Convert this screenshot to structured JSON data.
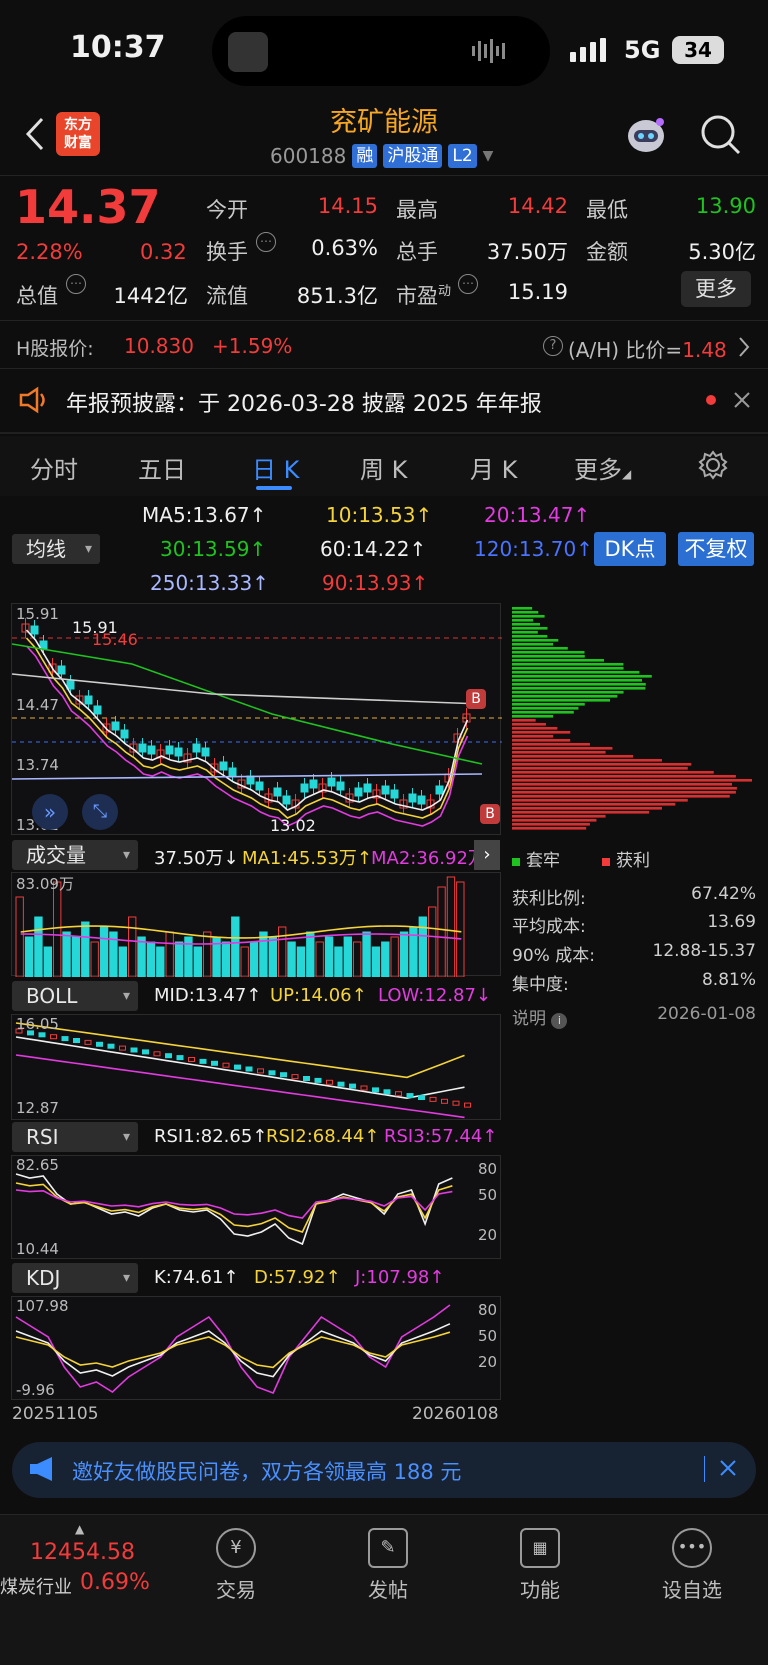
{
  "status": {
    "time": "10:37",
    "network": "5G",
    "battery": "34"
  },
  "header": {
    "logo_line1": "东方",
    "logo_line2": "财富",
    "title": "兖矿能源",
    "code": "600188",
    "tags": [
      "融",
      "沪股通",
      "L2"
    ]
  },
  "quote": {
    "price": "14.37",
    "pct": "2.28%",
    "change": "0.32",
    "open_label": "今开",
    "open": "14.15",
    "high_label": "最高",
    "high": "14.42",
    "low_label": "最低",
    "low": "13.90",
    "turnover_label": "换手",
    "turnover": "0.63%",
    "volume_label": "总手",
    "volume": "37.50万",
    "amount_label": "金额",
    "amount": "5.30亿",
    "mcap_label": "总值",
    "mcap": "1442亿",
    "float_label": "流值",
    "float": "851.3亿",
    "pe_label": "市盈",
    "pe_sup": "动",
    "pe": "15.19",
    "more": "更多"
  },
  "hshare": {
    "label": "H股报价:",
    "price": "10.830",
    "pct": "+1.59%",
    "ah_label": "(A/H) 比价=",
    "ah": "1.48"
  },
  "notice": {
    "text": "年报预披露：于 2026-03-28 披露 2025 年年报"
  },
  "tabs": [
    "分时",
    "五日",
    "日 K",
    "周 K",
    "月 K",
    "更多"
  ],
  "ma": {
    "selector": "均线",
    "ma5": "MA5:13.67↑",
    "ma10": "10:13.53↑",
    "ma20": "20:13.47↑",
    "ma30": "30:13.59↑",
    "ma60": "60:14.22↑",
    "ma120": "120:13.70↑",
    "ma250": "250:13.33↑",
    "ma90": "90:13.93↑",
    "dk": "DK点",
    "fq": "不复权"
  },
  "kline": {
    "y_labels": [
      "15.91",
      "14.47",
      "13.74",
      "13.02"
    ],
    "high_mark": "15.91",
    "low_mark": "13.02",
    "dash_price": "15.46",
    "b_marker": "B"
  },
  "volume_ind": {
    "selector": "成交量",
    "val": "37.50万↓",
    "ma1": "MA1:45.53万↑",
    "ma2": "MA2:36.92万",
    "y_top": "83.09万"
  },
  "boll": {
    "selector": "BOLL",
    "mid": "MID:13.47↑",
    "up": "UP:14.06↑",
    "low": "LOW:12.87↓",
    "y_top": "16.05",
    "y_bottom": "12.87"
  },
  "rsi": {
    "selector": "RSI",
    "rsi1": "RSI1:82.65↑",
    "rsi2": "RSI2:68.44↑",
    "rsi3": "RSI3:57.44↑",
    "y_top": "82.65",
    "y_bottom": "10.44",
    "levels": [
      "80",
      "50",
      "20"
    ]
  },
  "kdj": {
    "selector": "KDJ",
    "k": "K:74.61↑",
    "d": "D:57.92↑",
    "j": "J:107.98↑",
    "y_top": "107.98",
    "y_bottom": "-9.96",
    "levels": [
      "80",
      "50",
      "20"
    ],
    "date_start": "20251105",
    "date_end": "20260108"
  },
  "chip": {
    "legend_green": "套牢",
    "legend_red": "获利",
    "stats": [
      {
        "label": "获利比例:",
        "value": "67.42%"
      },
      {
        "label": "平均成本:",
        "value": "13.69"
      },
      {
        "label": "90% 成本:",
        "value": "12.88-15.37"
      },
      {
        "label": "集中度:",
        "value": "8.81%"
      }
    ],
    "note": "说明",
    "date": "2026-01-08"
  },
  "banner": {
    "text": "邀好友做股民问卷，双方各领最高 188 元"
  },
  "bottom": {
    "index": "12454.58",
    "industry": "煤炭行业",
    "industry_pct": "0.69%",
    "items": [
      "交易",
      "发帖",
      "功能",
      "设自选"
    ]
  }
}
